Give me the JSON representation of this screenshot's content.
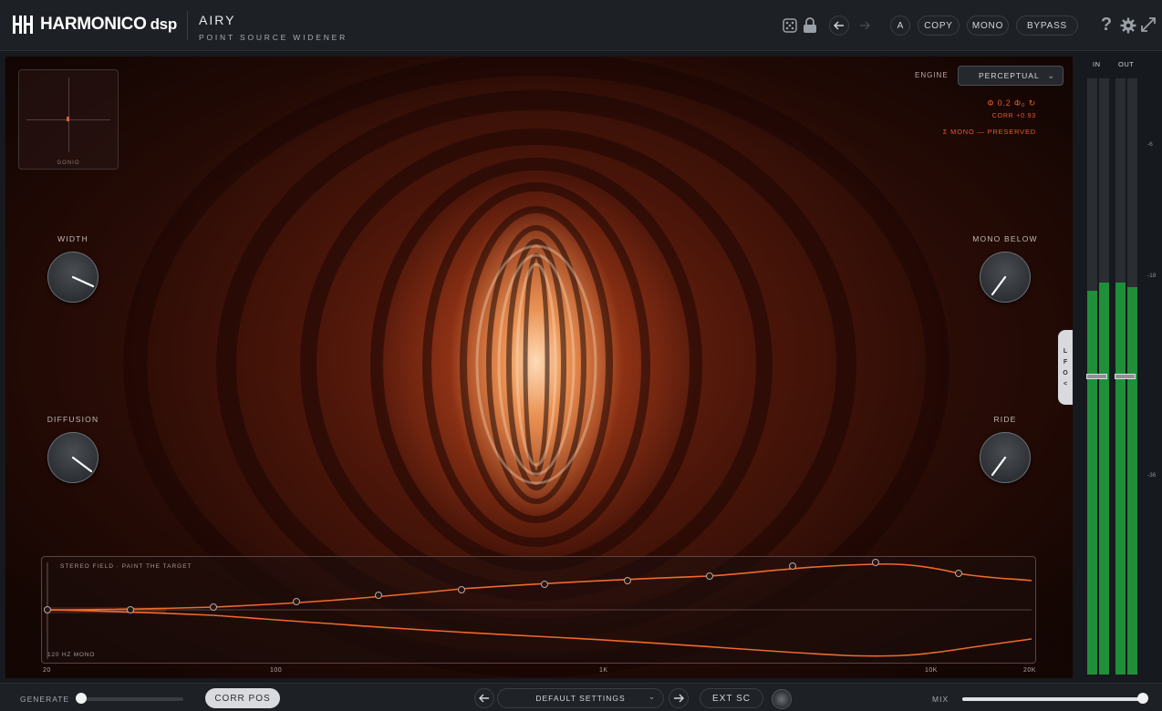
{
  "header": {
    "brand": "HARMONICO",
    "brand_suffix": "dsp",
    "plugin_name": "AIRY",
    "plugin_subtitle": "POINT SOURCE WIDENER",
    "ab_label": "A",
    "copy_label": "COPY",
    "mono_label": "MONO",
    "bypass_label": "BYPASS",
    "help_label": "?"
  },
  "engine": {
    "label": "ENGINE",
    "value": "PERCEPTUAL"
  },
  "readout": {
    "phase": "Φ 0.2 Φ₀ ↻",
    "corr": "CORR +0.93",
    "mono": "Σ MONO — PRESERVED"
  },
  "gonio": {
    "label": "GONIO"
  },
  "knobs": [
    {
      "label": "WIDTH"
    },
    {
      "label": "DIFFUSION"
    },
    {
      "label": "MONO BELOW"
    },
    {
      "label": "RIDE"
    }
  ],
  "lfo": {
    "letters": [
      "L",
      "F",
      "O",
      "<"
    ]
  },
  "stereo_field": {
    "title": "STEREO FIELD · PAINT THE TARGET",
    "bottom_label": "120 HZ MONO",
    "freq_ticks": [
      "20",
      "100",
      "1K",
      "10K",
      "20K"
    ]
  },
  "meters": {
    "in_label": "IN",
    "out_label": "OUT",
    "db_ticks": [
      "-6",
      "-18",
      "-36"
    ]
  },
  "footer": {
    "generate_label": "GENERATE",
    "corr_pos_label": "CORR POS",
    "preset": "DEFAULT SETTINGS",
    "ext_sc_label": "EXT SC",
    "mix_label": "MIX"
  },
  "colors": {
    "accent": "#e55a2c",
    "meter_green": "#1f8f3a",
    "panel": "#1d2024"
  }
}
